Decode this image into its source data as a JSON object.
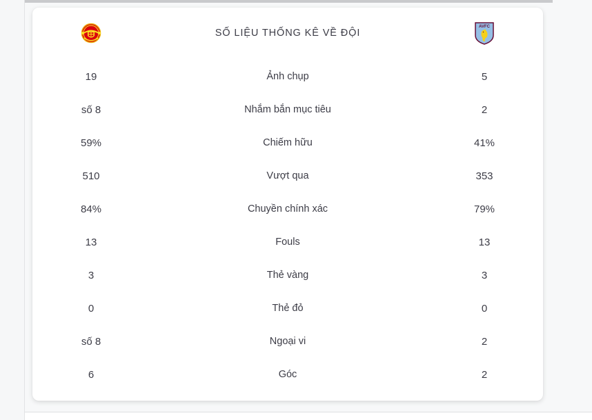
{
  "header": {
    "title": "SỐ LIỆU THỐNG KÊ VỀ ĐỘI",
    "home_team": {
      "name": "Manchester United",
      "icon": "manchester-united-crest",
      "colors": {
        "primary": "#da020e",
        "secondary": "#fbe122",
        "outline": "#e0a800"
      }
    },
    "away_team": {
      "name": "Aston Villa",
      "icon": "aston-villa-crest",
      "abbreviation": "AVFC",
      "colors": {
        "primary": "#95bfe5",
        "secondary": "#670e36",
        "lion": "#f5d01a"
      }
    }
  },
  "text_color": "#3c3c46",
  "stats": [
    {
      "home": "19",
      "label": "Ảnh chụp",
      "away": "5"
    },
    {
      "home": "số 8",
      "label": "Nhắm bắn mục tiêu",
      "away": "2"
    },
    {
      "home": "59%",
      "label": "Chiếm hữu",
      "away": "41%"
    },
    {
      "home": "510",
      "label": "Vượt qua",
      "away": "353"
    },
    {
      "home": "84%",
      "label": "Chuyền chính xác",
      "away": "79%"
    },
    {
      "home": "13",
      "label": "Fouls",
      "away": "13"
    },
    {
      "home": "3",
      "label": "Thẻ vàng",
      "away": "3"
    },
    {
      "home": "0",
      "label": "Thẻ đỏ",
      "away": "0"
    },
    {
      "home": "số 8",
      "label": "Ngoại vi",
      "away": "2"
    },
    {
      "home": "6",
      "label": "Góc",
      "away": "2"
    }
  ]
}
